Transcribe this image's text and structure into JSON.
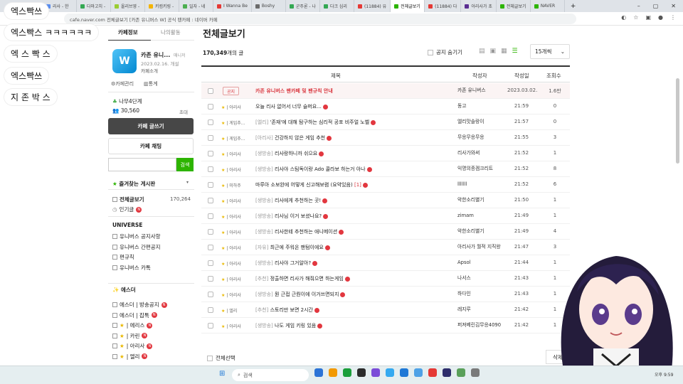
{
  "browser": {
    "tabs": [
      {
        "label": "리사 - 한",
        "color": "#5a8dee"
      },
      {
        "label": "다마고치 -",
        "color": "#34a853"
      },
      {
        "label": "올리브영 -",
        "color": "#9acd32"
      },
      {
        "label": "키컴키링 -",
        "color": "#f4b400"
      },
      {
        "label": "일자 - 네",
        "color": "#4caf50"
      },
      {
        "label": "I Wanna Be",
        "color": "#e53935"
      },
      {
        "label": "Boshy",
        "color": "#6b6b6b"
      },
      {
        "label": "군주론 - 나",
        "color": "#34a853"
      },
      {
        "label": "다크 심리",
        "color": "#34a853"
      },
      {
        "label": "(11884) 유",
        "color": "#e53935"
      },
      {
        "label": "전체글보기",
        "color": "#2db400",
        "active": true
      },
      {
        "label": "(11884) 다",
        "color": "#e53935"
      },
      {
        "label": "아리사가 초",
        "color": "#5a2d91"
      },
      {
        "label": "전체글보기",
        "color": "#2db400"
      },
      {
        "label": "NAVER",
        "color": "#2db400"
      }
    ],
    "url": "cafe.naver.com  전체글보기 [카존 유니버스 W] 공식 팬카페 : 네이버 카페",
    "new_tab": "+",
    "controls": {
      "min": "–",
      "max": "▢",
      "close": "✕"
    }
  },
  "overlay_labels": [
    "엑스빡쓰",
    "엑스빡스 ㅋㅋㅋㅋㅋㅋ",
    "엑 스 빡 스",
    "엑스빡쓰",
    "지 존 박 스"
  ],
  "sidebar": {
    "tabs": [
      "카페정보",
      "나의활동"
    ],
    "cafe_name": "카존 유니...",
    "manager": "매니저",
    "since": "2023.02.16. 개설",
    "intro": "카페소개",
    "admin": "카페관리",
    "stats": "통계",
    "level": "나무4단계",
    "members": "30,560",
    "invite": "초대",
    "write_btn": "카페 글쓰기",
    "chat_btn": "카페 채팅",
    "search_btn": "검색",
    "fav_header": "즐겨찾는 게시판",
    "all_posts": "전체글보기",
    "all_count": "170,264",
    "popular": "인기글",
    "universe_header": "UNIVERSE",
    "universe_items": [
      "유니버스 공지사항",
      "유니버스 간편공지",
      "편규칙",
      "유니버스 카톡"
    ],
    "es_header": "에스더",
    "es_items": [
      "에스더 | 방송공지",
      "에스더 | 잡톡",
      "| 에리스",
      "| 카린",
      "| 아리사",
      "| 엘리"
    ]
  },
  "main": {
    "title": "전체글보기",
    "count": "170,349",
    "count_suffix": "개의 글",
    "hide_notice": "공지 숨기기",
    "per_page": "15개씩",
    "headers": {
      "title": "제목",
      "author": "작성자",
      "date": "작성일",
      "views": "조회수"
    },
    "select_all": "전체선택",
    "delete": "삭제",
    "rows": [
      {
        "cat": "공지",
        "prefix": "",
        "title": "카존 유니버스 팬카페 및 팬규칙 안내",
        "author": "카존 유니버스",
        "date": "2023.03.02.",
        "views": "1.6만",
        "notice": true
      },
      {
        "cat": "| 아리사",
        "prefix": "",
        "title": "오늘 리사 없어서 너무 슬퍼요...",
        "author": "동고",
        "date": "21:59",
        "views": "0"
      },
      {
        "cat": "| 게임추...",
        "prefix": "[엘리]",
        "title": " '존재'에 대해 탐구하는 심리적 공포 비주얼 노벨",
        "author": "엘리맛솔랑이",
        "date": "21:57",
        "views": "0"
      },
      {
        "cat": "| 게임추...",
        "prefix": "[아리사]",
        "title": " 건강하지 않은 게임 추천",
        "author": "무응무응무응",
        "date": "21:55",
        "views": "3"
      },
      {
        "cat": "| 아리사",
        "prefix": "[생방송]",
        "title": " 리사랑하니까 쉬으요",
        "author": "리사가와써",
        "date": "21:52",
        "views": "1"
      },
      {
        "cat": "| 아리사",
        "prefix": "[생방송]",
        "title": " 리사야 스팀독이랑 Ado 콜라보 하는거 아나",
        "author": "익명의종겜크리트",
        "date": "21:52",
        "views": "8"
      },
      {
        "cat": "| 미하주",
        "prefix": "",
        "title": "마루아 소보완에 어떻게 신고해보렴 (요약있음)",
        "comments": "[1]",
        "author": "lllllll",
        "date": "21:52",
        "views": "6"
      },
      {
        "cat": "| 아리사",
        "prefix": "[생방송]",
        "title": " 리사에게 추천하는 곳!",
        "author": "악한소리별기",
        "date": "21:50",
        "views": "1"
      },
      {
        "cat": "| 아리사",
        "prefix": "[생방송]",
        "title": " 리사님 이거 보셨나요?",
        "author": "zimam",
        "date": "21:49",
        "views": "1"
      },
      {
        "cat": "| 아리사",
        "prefix": "[생방송]",
        "title": " 리사한테 추천하는 애니메이션",
        "author": "악한소리별기",
        "date": "21:49",
        "views": "4"
      },
      {
        "cat": "| 아리사",
        "prefix": "[자유]",
        "title": " 최근에 주워온 팬텀이에요",
        "author": "아리사가 월적 지직왕",
        "date": "21:47",
        "views": "3"
      },
      {
        "cat": "| 아리사",
        "prefix": "[생방송]",
        "title": " 리사야 그거알아?",
        "author": "Apsol",
        "date": "21:44",
        "views": "1"
      },
      {
        "cat": "| 아리사",
        "prefix": "[추천]",
        "title": " 정출하면 리사가 해줘으면 하는게임",
        "author": "나서스",
        "date": "21:43",
        "views": "1"
      },
      {
        "cat": "| 아리사",
        "prefix": "[생방송]",
        "title": " 뭔 근접 근뤈이에 이거쓰면되지",
        "author": "하다인",
        "date": "21:43",
        "views": "1"
      },
      {
        "cat": "| 엘리",
        "prefix": "[추천]",
        "title": " 스토리만 보면 2시간",
        "author": "레지루",
        "date": "21:42",
        "views": "1"
      },
      {
        "cat": "| 아리사",
        "prefix": "[생방송]",
        "title": " 나도 게임 키링 있음",
        "author": "퍼져베린김무응4090",
        "date": "21:42",
        "views": "1"
      }
    ]
  },
  "taskbar": {
    "search": "검색",
    "clock": "오후 9:59"
  },
  "colors": {
    "accent": "#2db400",
    "notice": "#d9363e",
    "dark_btn": "#474747"
  }
}
